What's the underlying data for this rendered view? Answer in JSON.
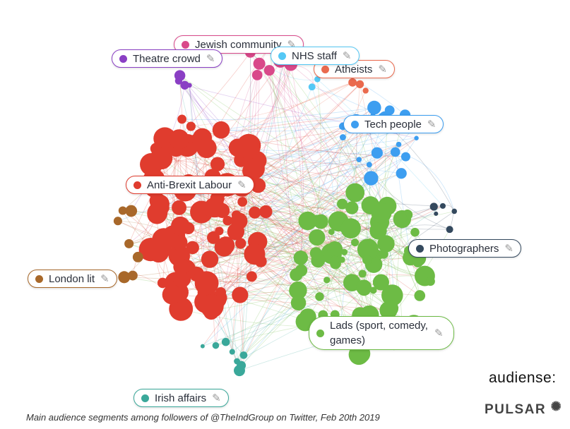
{
  "segments": [
    {
      "id": "jewish",
      "label": "Jewish community",
      "color": "#d9498a"
    },
    {
      "id": "theatre",
      "label": "Theatre crowd",
      "color": "#8a3fc4"
    },
    {
      "id": "nhs",
      "label": "NHS staff",
      "color": "#55c8f5"
    },
    {
      "id": "atheists",
      "label": "Atheists",
      "color": "#ea6a4e"
    },
    {
      "id": "tech",
      "label": "Tech people",
      "color": "#3d9ef0"
    },
    {
      "id": "labour",
      "label": "Anti-Brexit Labour",
      "color": "#e03c2e"
    },
    {
      "id": "photographers",
      "label": "Photographers",
      "color": "#34495e"
    },
    {
      "id": "london",
      "label": "London lit",
      "color": "#a8682a"
    },
    {
      "id": "lads",
      "label": "Lads (sport, comedy, games)",
      "color": "#6dbb45"
    },
    {
      "id": "irish",
      "label": "Irish affairs",
      "color": "#3aa89a"
    }
  ],
  "edit_icon": "pencil-icon",
  "caption": "Main audience segments among followers of @TheIndGroup on Twitter, Feb 20th 2019",
  "logos": {
    "audiense": "audiense:",
    "pulsar": "PULSAR"
  }
}
